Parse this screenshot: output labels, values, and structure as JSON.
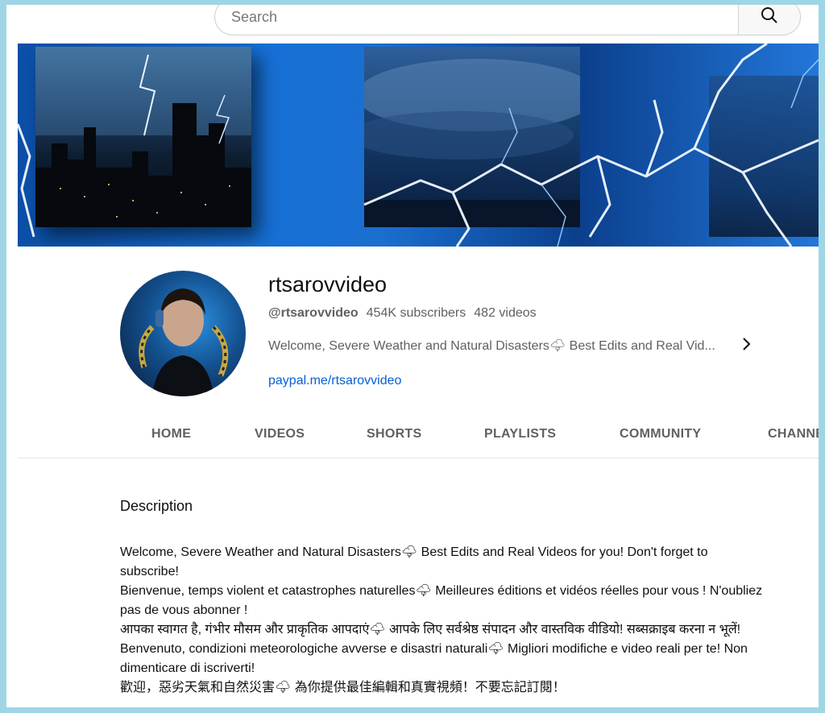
{
  "search": {
    "placeholder": "Search",
    "icon": "search-icon"
  },
  "channel": {
    "name": "rtsarovvideo",
    "handle": "@rtsarovvideo",
    "subscribers": "454K subscribers",
    "videos": "482 videos",
    "short_description": "Welcome, Severe Weather and Natural Disasters🌩 Best Edits and Real Vid...",
    "link": "paypal.me/rtsarovvideo"
  },
  "tabs": [
    "HOME",
    "VIDEOS",
    "SHORTS",
    "PLAYLISTS",
    "COMMUNITY",
    "CHANNELS"
  ],
  "description": {
    "title": "Description",
    "lines": [
      "Welcome, Severe Weather and Natural Disasters🌩 Best Edits and Real Videos for you! Don't forget to subscribe!",
      "Bienvenue, temps violent et catastrophes naturelles🌩 Meilleures éditions et vidéos réelles pour vous ! N'oubliez pas de vous abonner !",
      "आपका स्वागत है, गंभीर मौसम और प्राकृतिक आपदाएं🌩 आपके लिए सर्वश्रेष्ठ संपादन और वास्तविक वीडियो! सब्सक्राइब करना न भूलें!",
      "Benvenuto, condizioni meteorologiche avverse e disastri naturali🌩 Migliori modifiche e video reali per te! Non dimenticare di iscriverti!",
      "歡迎，惡劣天氣和自然災害🌩 為你提供最佳編輯和真實視頻！不要忘記訂閱！"
    ]
  },
  "colors": {
    "link": "#065fd4",
    "muted": "#606060",
    "border": "#9fd6e6"
  }
}
